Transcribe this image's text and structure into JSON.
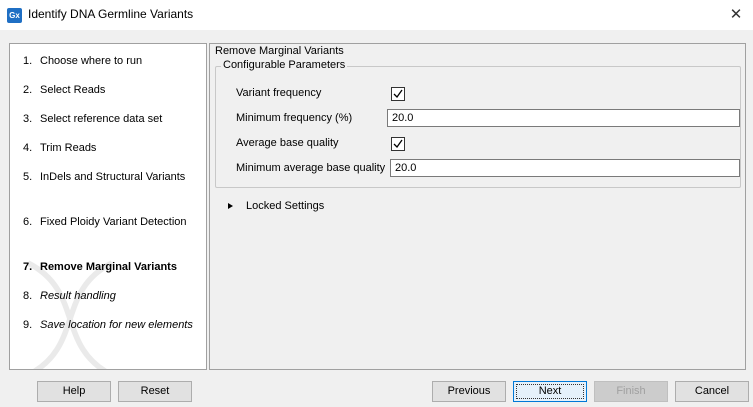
{
  "window": {
    "app_icon_text": "Gx",
    "title": "Identify DNA Germline Variants",
    "close_glyph": "✕"
  },
  "sidebar": {
    "steps": [
      {
        "num": "1.",
        "label": "Choose where to run",
        "state": "done"
      },
      {
        "num": "2.",
        "label": "Select Reads",
        "state": "done"
      },
      {
        "num": "3.",
        "label": "Select reference data set",
        "state": "done"
      },
      {
        "num": "4.",
        "label": "Trim Reads",
        "state": "done"
      },
      {
        "num": "5.",
        "label": "InDels and Structural Variants",
        "state": "done"
      },
      {
        "num": "6.",
        "label": "Fixed Ploidy Variant Detection",
        "state": "done"
      },
      {
        "num": "7.",
        "label": "Remove Marginal Variants",
        "state": "active"
      },
      {
        "num": "8.",
        "label": "Result handling",
        "state": "future"
      },
      {
        "num": "9.",
        "label": "Save location for new elements",
        "state": "future"
      }
    ]
  },
  "main": {
    "section_title": "Remove Marginal Variants",
    "group_title": "Configurable Parameters",
    "params": {
      "variant_frequency": {
        "label": "Variant frequency",
        "checked": true
      },
      "min_frequency": {
        "label": "Minimum frequency (%)",
        "value": "20.0"
      },
      "avg_base_quality": {
        "label": "Average base quality",
        "checked": true
      },
      "min_avg_base_quality": {
        "label": "Minimum average base quality",
        "value": "20.0"
      }
    },
    "locked_settings": "Locked Settings"
  },
  "buttons": {
    "help": "Help",
    "reset": "Reset",
    "previous": "Previous",
    "next": "Next",
    "finish": "Finish",
    "cancel": "Cancel"
  },
  "colors": {
    "accent": "#0078d7",
    "app_icon": "#1f6fc4",
    "dialog_bg": "#f0f0f0"
  }
}
